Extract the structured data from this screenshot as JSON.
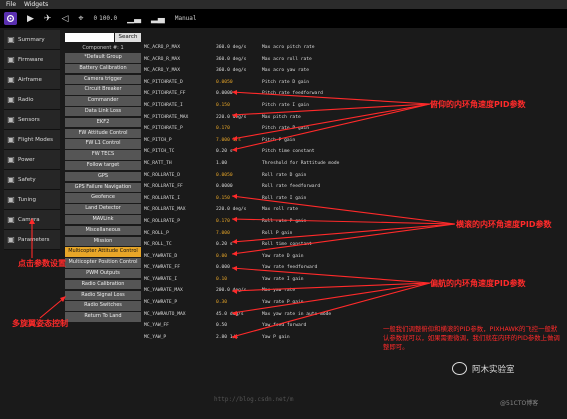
{
  "menu": [
    "File",
    "Widgets"
  ],
  "toolbar": {
    "count_text": "0",
    "hdop_text": "100.0",
    "mode": "Manual"
  },
  "sidebar": [
    {
      "label": "Summary",
      "icon": "summary-icon"
    },
    {
      "label": "Firmware",
      "icon": "firmware-icon"
    },
    {
      "label": "Airframe",
      "icon": "airframe-icon"
    },
    {
      "label": "Radio",
      "icon": "radio-icon"
    },
    {
      "label": "Sensors",
      "icon": "sensors-icon"
    },
    {
      "label": "Flight Modes",
      "icon": "flight-modes-icon"
    },
    {
      "label": "Power",
      "icon": "power-icon"
    },
    {
      "label": "Safety",
      "icon": "safety-icon"
    },
    {
      "label": "Tuning",
      "icon": "tuning-icon"
    },
    {
      "label": "Camera",
      "icon": "camera-icon"
    },
    {
      "label": "Parameters",
      "icon": "parameters-icon"
    }
  ],
  "search": {
    "button": "Search",
    "component": "Component #: 1"
  },
  "groups": [
    "*Default Group",
    "Battery Calibration",
    "Camera trigger",
    "Circuit Breaker",
    "Commander",
    "Data Link Loss",
    "EKF2",
    "FW Attitude Control",
    "FW L1 Control",
    "FW TECS",
    "Follow target",
    "GPS",
    "GPS Failure Navigation",
    "Geofence",
    "Land Detector",
    "MAVLink",
    "Miscellaneous",
    "Mission",
    "Multicopter Attitude Control",
    "Multicopter Position Control",
    "PWM Outputs",
    "Radio Calibration",
    "Radio Signal Loss",
    "Radio Switches",
    "Return To Land"
  ],
  "selected_group": "Multicopter Attitude Control",
  "params": [
    {
      "name": "MC_ACRO_P_MAX",
      "value": "360.0 deg/s",
      "desc": "Max acro pitch rate"
    },
    {
      "name": "MC_ACRO_R_MAX",
      "value": "360.0 deg/s",
      "desc": "Max acro roll rate"
    },
    {
      "name": "MC_ACRO_Y_MAX",
      "value": "360.0 deg/s",
      "desc": "Max acro yaw rate"
    },
    {
      "name": "MC_PITCHRATE_D",
      "value": "0.0050",
      "desc": "Pitch rate D gain",
      "hl": true
    },
    {
      "name": "MC_PITCHRATE_FF",
      "value": "0.0000",
      "desc": "Pitch rate feedforward"
    },
    {
      "name": "MC_PITCHRATE_I",
      "value": "0.150",
      "desc": "Pitch rate I gain",
      "hl": true
    },
    {
      "name": "MC_PITCHRATE_MAX",
      "value": "220.0 deg/s",
      "desc": "Max pitch rate"
    },
    {
      "name": "MC_PITCHRATE_P",
      "value": "0.170",
      "desc": "Pitch rate P gain",
      "hl": true
    },
    {
      "name": "MC_PITCH_P",
      "value": "7.000 1/s",
      "desc": "Pitch P gain",
      "hl": true
    },
    {
      "name": "MC_PITCH_TC",
      "value": "0.20 s",
      "desc": "Pitch time constant"
    },
    {
      "name": "MC_RATT_TH",
      "value": "1.00",
      "desc": "Threshold for Rattitude mode"
    },
    {
      "name": "MC_ROLLRATE_D",
      "value": "0.0050",
      "desc": "Roll rate D gain",
      "hl": true
    },
    {
      "name": "MC_ROLLRATE_FF",
      "value": "0.0000",
      "desc": "Roll rate feedforward"
    },
    {
      "name": "MC_ROLLRATE_I",
      "value": "0.150",
      "desc": "Roll rate I gain",
      "hl": true
    },
    {
      "name": "MC_ROLLRATE_MAX",
      "value": "220.0 deg/s",
      "desc": "Max roll rate"
    },
    {
      "name": "MC_ROLLRATE_P",
      "value": "0.170",
      "desc": "Roll rate P gain",
      "hl": true
    },
    {
      "name": "MC_ROLL_P",
      "value": "7.000",
      "desc": "Roll P gain",
      "hl": true
    },
    {
      "name": "MC_ROLL_TC",
      "value": "0.20 s",
      "desc": "Roll time constant"
    },
    {
      "name": "MC_YAWRATE_D",
      "value": "0.00",
      "desc": "Yaw rate D gain",
      "hl": true
    },
    {
      "name": "MC_YAWRATE_FF",
      "value": "0.000",
      "desc": "Yaw rate feedforward"
    },
    {
      "name": "MC_YAWRATE_I",
      "value": "0.10",
      "desc": "Yaw rate I gain",
      "hl": true
    },
    {
      "name": "MC_YAWRATE_MAX",
      "value": "200.0 deg/s",
      "desc": "Max yaw rate"
    },
    {
      "name": "MC_YAWRATE_P",
      "value": "0.30",
      "desc": "Yaw rate P gain",
      "hl": true
    },
    {
      "name": "MC_YAWRAUTO_MAX",
      "value": "45.0 deg/s",
      "desc": "Max yaw rate in auto mode"
    },
    {
      "name": "MC_YAW_FF",
      "value": "0.50",
      "desc": "Yaw feed forward"
    },
    {
      "name": "MC_YAW_P",
      "value": "2.80 1/s",
      "desc": "Yaw P gain"
    }
  ],
  "annotations": {
    "pitch": "俯仰的内环角速度PID参数",
    "roll": "横滚的内环角速度PID参数",
    "yaw": "偏航的内环角速度PID参数",
    "params": "点击参数设置",
    "attitude": "多旋翼姿态控制",
    "note": "一般我们调整俯仰和横滚的PID参数，PIXHAWK的飞控一般默认参数就可以，如果需要微调，我们就在内环的PID参数上做调整即可。"
  },
  "watermark": "http://blog.csdn.net/m",
  "lab_name": "阿木实验室",
  "copyright": "@51CTO博客",
  "colors": {
    "accent": "#e8a628",
    "annotation": "#ff2a2a",
    "active_tool": "#5a2fb0"
  }
}
